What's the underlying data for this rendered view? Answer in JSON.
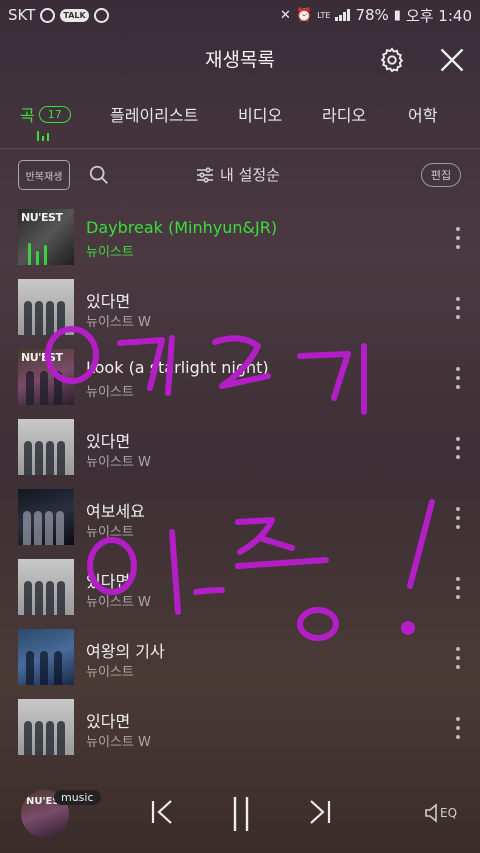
{
  "statusbar": {
    "carrier": "SKT",
    "talk_label": "TALK",
    "battery": "78%",
    "time": "오후 1:40",
    "lte_label": "LTE"
  },
  "header": {
    "title": "재생목록"
  },
  "tabs": [
    {
      "label": "곡",
      "count": "17",
      "active": true
    },
    {
      "label": "플레이리스트"
    },
    {
      "label": "비디오"
    },
    {
      "label": "라디오"
    },
    {
      "label": "어학"
    }
  ],
  "toolbar": {
    "repeat_label": "반복재생",
    "sort_label": "내 설정순",
    "edit_label": "편집"
  },
  "tracks": [
    {
      "title": "Daybreak (Minhyun&JR)",
      "artist": "뉴이스트",
      "active": true
    },
    {
      "title": "있다면",
      "artist": "뉴이스트 W"
    },
    {
      "title": "Look (a starlight night)",
      "artist": "뉴이스트"
    },
    {
      "title": "있다면",
      "artist": "뉴이스트 W"
    },
    {
      "title": "여보세요",
      "artist": "뉴이스트"
    },
    {
      "title": "있다면",
      "artist": "뉴이스트 W"
    },
    {
      "title": "여왕의 기사",
      "artist": "뉴이스트"
    },
    {
      "title": "있다면",
      "artist": "뉴이스트 W"
    }
  ],
  "album_logo": "NU'EST",
  "player": {
    "badge": "music",
    "eq_label": "EQ"
  },
  "colors": {
    "accent": "#3ddc3d",
    "handwriting": "#b31ec7"
  }
}
